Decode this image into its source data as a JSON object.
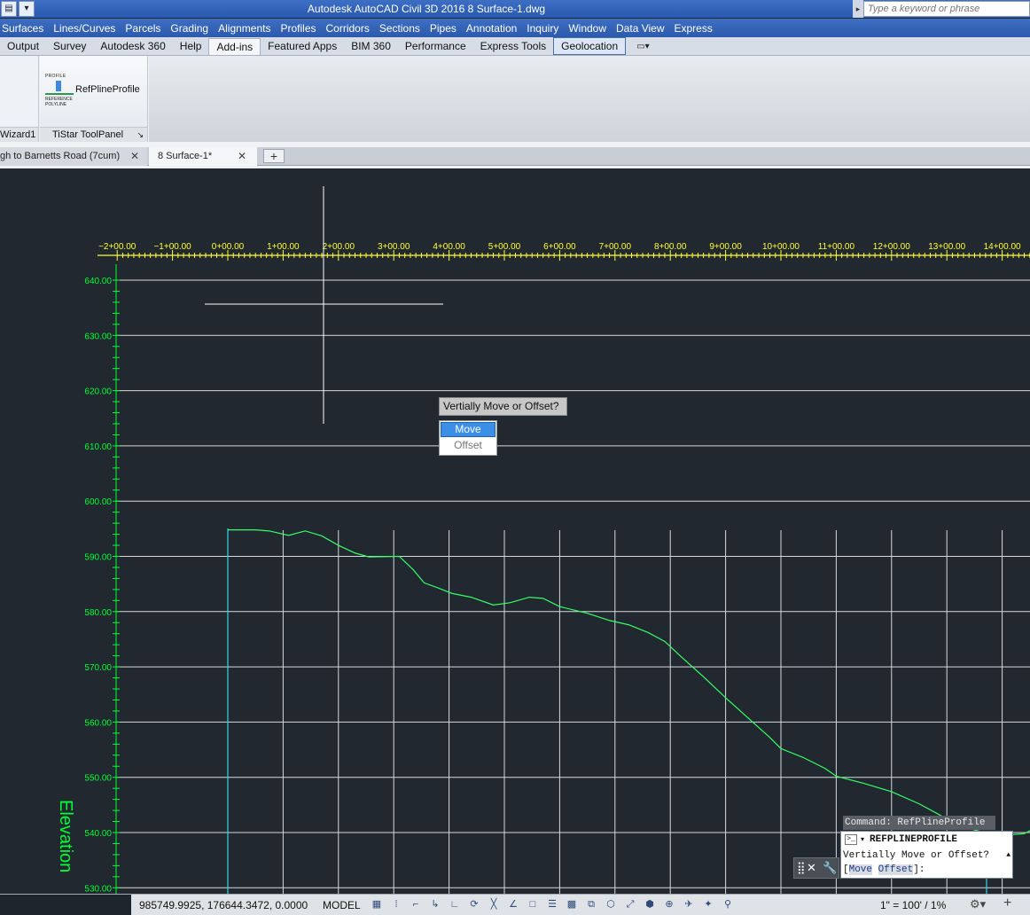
{
  "app": {
    "title": "Autodesk AutoCAD Civil 3D 2016    8 Surface-1.dwg",
    "search_placeholder": "Type a keyword or phrase"
  },
  "menubar": [
    "Surfaces",
    "Lines/Curves",
    "Parcels",
    "Grading",
    "Alignments",
    "Profiles",
    "Corridors",
    "Sections",
    "Pipes",
    "Annotation",
    "Inquiry",
    "Window",
    "Data View",
    "Express"
  ],
  "ribbon_tabs": [
    {
      "label": "Output",
      "state": ""
    },
    {
      "label": "Survey",
      "state": ""
    },
    {
      "label": "Autodesk 360",
      "state": ""
    },
    {
      "label": "Help",
      "state": ""
    },
    {
      "label": "Add-ins",
      "state": "active"
    },
    {
      "label": "Featured Apps",
      "state": ""
    },
    {
      "label": "BIM 360",
      "state": ""
    },
    {
      "label": "Performance",
      "state": ""
    },
    {
      "label": "Express Tools",
      "state": ""
    },
    {
      "label": "Geolocation",
      "state": "boxed"
    }
  ],
  "ribbon": {
    "panel1_label": "Wizard1",
    "panel2_label": "TiStar ToolPanel",
    "tool_label": "RefPlineProfile",
    "tool_icon_top": "PROFILE",
    "tool_icon_bottom": "REFERENCE POLYLINE"
  },
  "doc_tabs": {
    "tab1": "gh to Barnetts Road (7cum)",
    "tab2": "8 Surface-1*",
    "close": "✕",
    "new_tab": "+"
  },
  "profile_view": {
    "stations": [
      "−2+00.00",
      "−1+00.00",
      "0+00.00",
      "1+00.00",
      "2+00.00",
      "3+00.00",
      "4+00.00",
      "5+00.00",
      "6+00.00",
      "7+00.00",
      "8+00.00",
      "9+00.00",
      "10+00.00",
      "11+00.00",
      "12+00.00",
      "13+00.00",
      "14+00.00"
    ],
    "elevations": [
      "640.00",
      "630.00",
      "620.00",
      "610.00",
      "600.00",
      "590.00",
      "580.00",
      "570.00",
      "560.00",
      "550.00",
      "540.00",
      "530.00"
    ],
    "axis_label": "Elevation",
    "colors": {
      "axis_text": "#00ff33",
      "station_text": "#ffff33",
      "profile": "#33ff66",
      "grid": "#d9d9d9",
      "vertical": "#33d6e6"
    }
  },
  "prompt": {
    "question": "Vertially Move or Offset?",
    "options": [
      {
        "label": "Move",
        "selected": true
      },
      {
        "label": "Offset",
        "selected": false
      }
    ]
  },
  "command": {
    "history": "Command: RefPlineProfile",
    "current": "REFPLINEPROFILE",
    "line2": "Vertially Move or Offset?",
    "bracket_open": "[",
    "kw1": "Move",
    "kw2": "Offset",
    "bracket_close": "]:"
  },
  "statusbar": {
    "coords": "985749.9925, 176644.3472, 0.0000",
    "model": "MODEL",
    "scale": "1\" = 100' / 1%"
  }
}
